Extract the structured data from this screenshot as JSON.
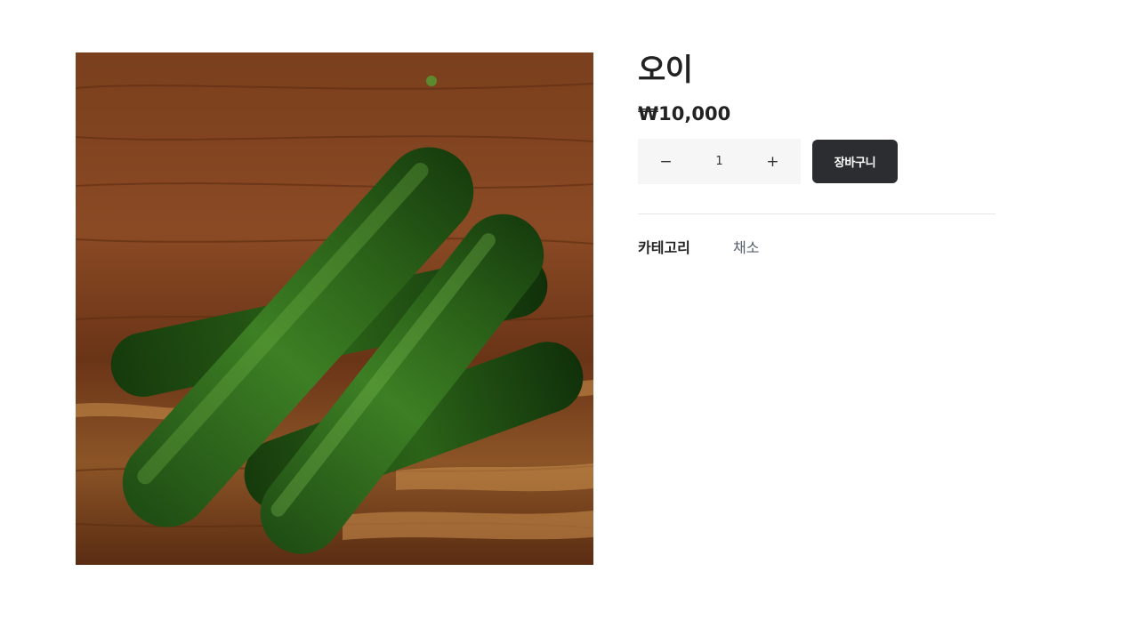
{
  "product": {
    "image": {
      "icon": "cucumber-photo",
      "background_color": "#6e3a1c",
      "vegetable_color": "#2f6b1e"
    },
    "title": "오이",
    "price": "₩10,000"
  },
  "quantity": {
    "decrement_label": "−",
    "value": "1",
    "increment_label": "+"
  },
  "cart": {
    "button_label": "장바구니",
    "button_color": "#2b2d30"
  },
  "meta": {
    "category_label": "카테고리",
    "category_value": "채소"
  }
}
